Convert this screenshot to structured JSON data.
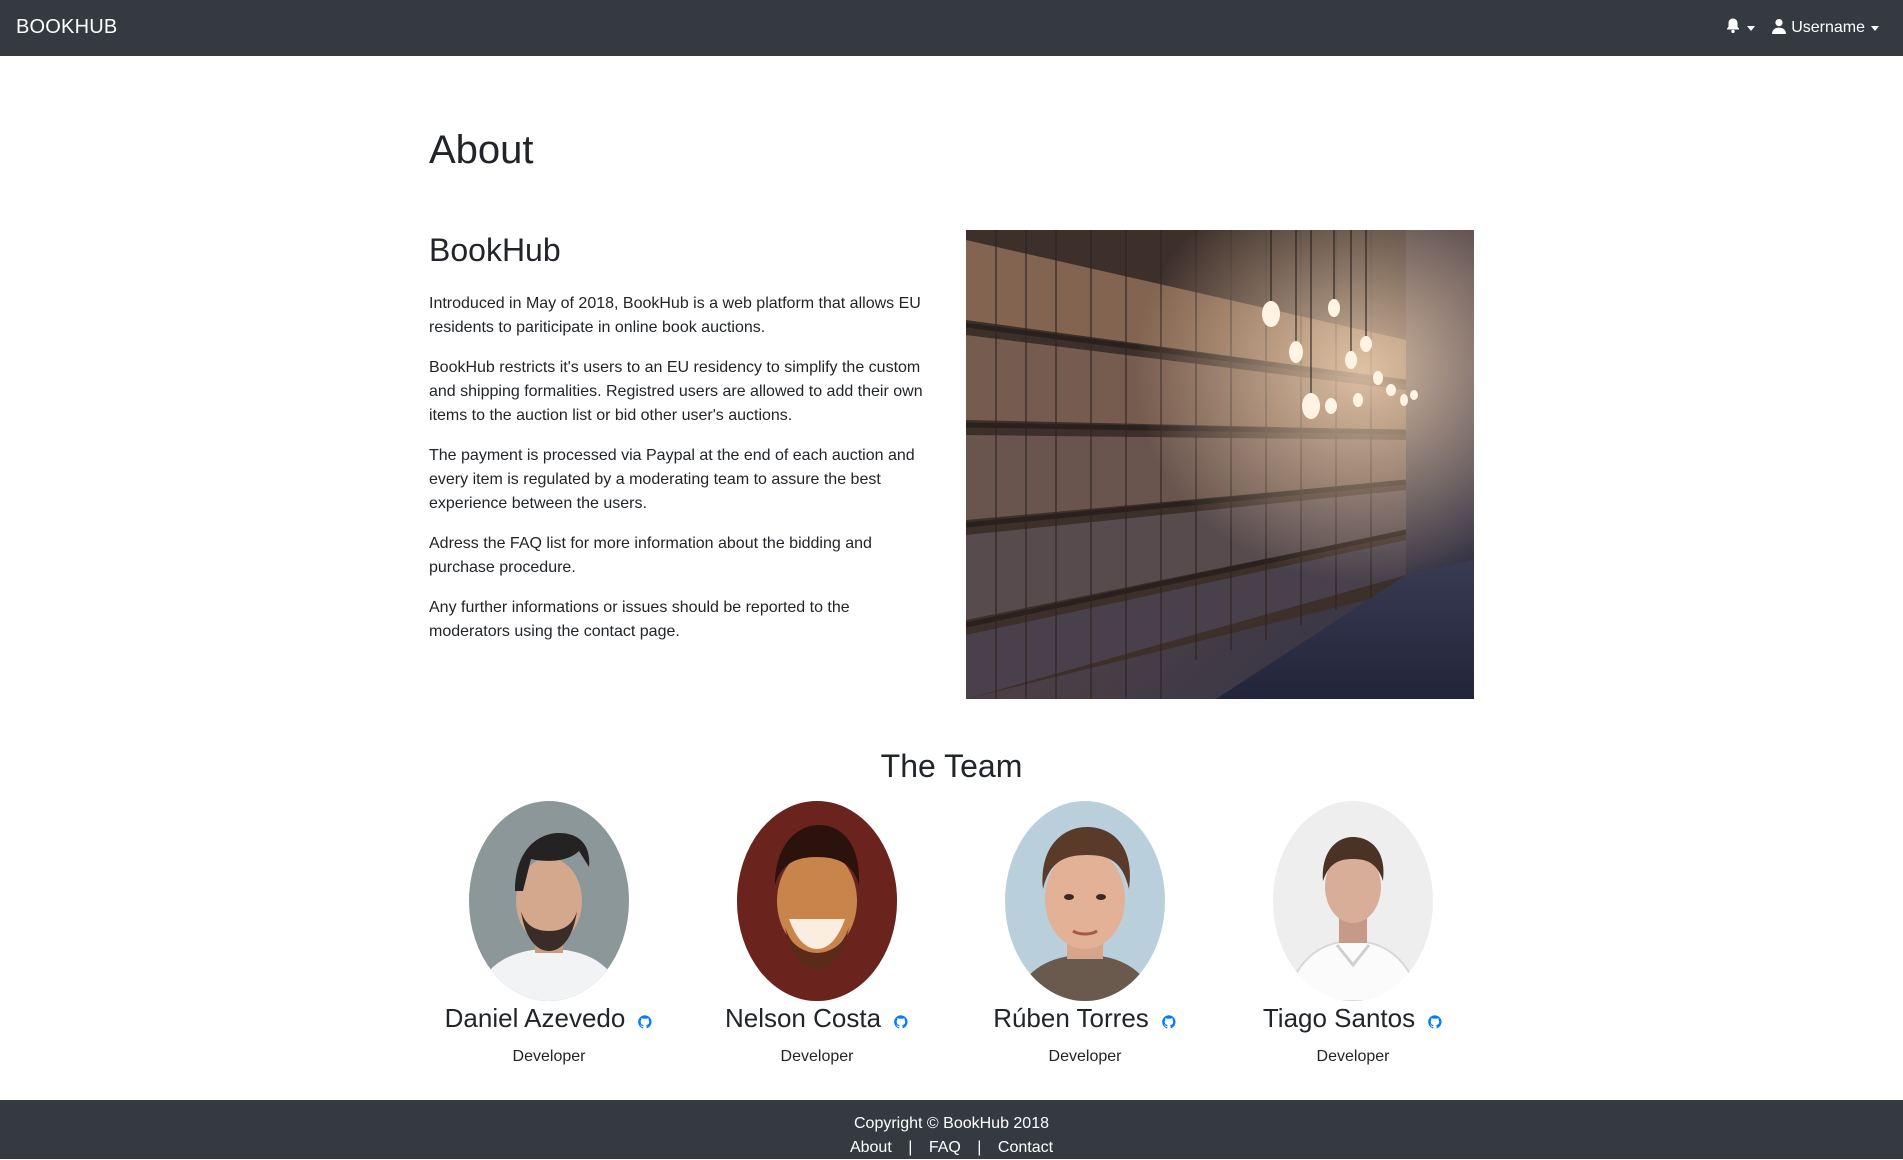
{
  "navbar": {
    "brand": "BOOKHUB",
    "notification_icon": "bell-icon",
    "user_icon": "user-icon",
    "username": "Username"
  },
  "page_title": "About",
  "about": {
    "heading": "BookHub",
    "paragraphs": [
      "Introduced in May of 2018, BookHub is a web platform that allows EU residents to pariticipate in online book auctions.",
      "BookHub restricts it's users to an EU residency to simplify the custom and shipping formalities. Registred users are allowed to add their own items to the auction list or bid other user's auctions.",
      "The payment is processed via Paypal at the end of each auction and every item is regulated by a moderating team to assure the best experience between the users.",
      "Adress the FAQ list for more information about the bidding and purchase procedure.",
      "Any further informations or issues should be reported to the moderators using the contact page."
    ]
  },
  "team": {
    "heading": "The Team",
    "members": [
      {
        "name": "Daniel Azevedo",
        "role": "Developer"
      },
      {
        "name": "Nelson Costa",
        "role": "Developer"
      },
      {
        "name": "Rúben Torres",
        "role": "Developer"
      },
      {
        "name": "Tiago Santos",
        "role": "Developer"
      }
    ]
  },
  "footer": {
    "copyright": "Copyright © BookHub 2018",
    "links": [
      "About",
      "FAQ",
      "Contact"
    ],
    "separator": "|"
  },
  "colors": {
    "navbar_bg": "#343a40",
    "github_icon": "#007bff"
  }
}
